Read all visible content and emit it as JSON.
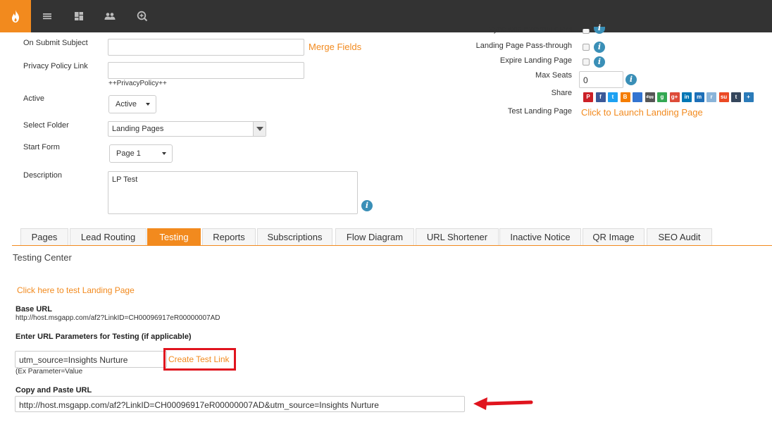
{
  "topbar": {
    "icons": [
      "flame-icon",
      "menu-icon",
      "dashboard-icon",
      "people-icon",
      "search-plus-icon"
    ]
  },
  "form": {
    "on_submit_subject_label": "On Submit Subject",
    "on_submit_subject_value": "",
    "merge_fields_link": "Merge Fields",
    "privacy_policy_label": "Privacy Policy Link",
    "privacy_policy_value": "",
    "privacy_policy_hint": "++PrivacyPolicy++",
    "active_label": "Active",
    "active_value": "Active",
    "select_folder_label": "Select Folder",
    "select_folder_value": "Landing Pages",
    "start_form_label": "Start Form",
    "start_form_value": "Page 1",
    "description_label": "Description",
    "description_value": "LP Test"
  },
  "right_panel": {
    "sync_label": "Sync with External CRM",
    "passthrough_label": "Landing Page Pass-through",
    "expire_label": "Expire Landing Page",
    "max_seats_label": "Max Seats",
    "max_seats_value": "0",
    "share_label": "Share",
    "test_label": "Test Landing Page",
    "test_link": "Click to Launch Landing Page",
    "share_icons": [
      {
        "name": "pinterest-icon",
        "glyph": "P",
        "color": "#cb2027"
      },
      {
        "name": "facebook-icon",
        "glyph": "f",
        "color": "#3b5998"
      },
      {
        "name": "twitter-icon",
        "glyph": "t",
        "color": "#1da1f2"
      },
      {
        "name": "blogger-icon",
        "glyph": "B",
        "color": "#f57d00"
      },
      {
        "name": "delicious-icon",
        "glyph": "",
        "color": "#3274d1"
      },
      {
        "name": "digg-icon",
        "glyph": "digg",
        "color": "#555555"
      },
      {
        "name": "google-icon",
        "glyph": "g",
        "color": "#34a853"
      },
      {
        "name": "google-plus-icon",
        "glyph": "g+",
        "color": "#dd4b39"
      },
      {
        "name": "linkedin-icon",
        "glyph": "in",
        "color": "#0077b5"
      },
      {
        "name": "myspace-icon",
        "glyph": "m",
        "color": "#1d6fb8"
      },
      {
        "name": "reddit-icon",
        "glyph": "r",
        "color": "#8ab4d9"
      },
      {
        "name": "stumbleupon-icon",
        "glyph": "su",
        "color": "#eb4924"
      },
      {
        "name": "tumblr-icon",
        "glyph": "t",
        "color": "#35465c"
      },
      {
        "name": "more-share-icon",
        "glyph": "+",
        "color": "#2b7bb9"
      }
    ]
  },
  "tabs": [
    {
      "label": "Pages",
      "active": false
    },
    {
      "label": "Lead Routing",
      "active": false
    },
    {
      "label": "Testing",
      "active": true
    },
    {
      "label": "Reports",
      "active": false
    },
    {
      "label": "Subscriptions",
      "active": false
    },
    {
      "label": "Flow Diagram",
      "active": false
    },
    {
      "label": "URL Shortener",
      "active": false
    },
    {
      "label": "Inactive Notice",
      "active": false
    },
    {
      "label": "QR Image",
      "active": false
    },
    {
      "label": "SEO Audit",
      "active": false
    }
  ],
  "testing": {
    "title": "Testing Center",
    "test_link": "Click here to test Landing Page",
    "base_url_label": "Base URL",
    "base_url_value": "http://host.msgapp.com/af2?LinkID=CH00096917eR00000007AD",
    "params_label": "Enter URL Parameters for Testing (if applicable)",
    "params_value": "utm_source=Insights Nurture",
    "create_link": "Create Test Link",
    "params_example": "(Ex Parameter=Value",
    "copy_label": "Copy and Paste URL",
    "copy_value": "http://host.msgapp.com/af2?LinkID=CH00096917eR00000007AD&utm_source=Insights Nurture"
  },
  "colors": {
    "accent": "#f28a1e",
    "topbar": "#333333",
    "info": "#3a8fb7",
    "highlight": "#e0141e"
  }
}
